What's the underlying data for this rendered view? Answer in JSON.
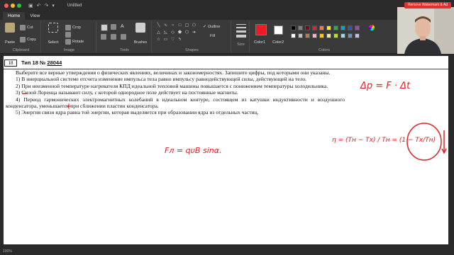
{
  "window": {
    "title": "Untitled"
  },
  "tabs": [
    "Home",
    "View"
  ],
  "ribbon": {
    "clipboard": {
      "paste": "Paste",
      "cut": "Cut",
      "copy": "Copy",
      "label": "Clipboard"
    },
    "image": {
      "select": "Select",
      "crop": "Crop",
      "rotate": "Rotate",
      "label": "Image"
    },
    "tools": {
      "label": "Tools",
      "brushes": "Brushes"
    },
    "shapes": {
      "outline": "Outline",
      "fill": "Fill",
      "label": "Shapes"
    },
    "size": {
      "label": "Size"
    },
    "colors": {
      "color1": "Color1",
      "color2": "Color2",
      "edit": "Edit colors",
      "label": "Colors",
      "swatches": [
        "#000000",
        "#7f7f7f",
        "#880015",
        "#ed1c24",
        "#ff7f27",
        "#fff200",
        "#22b14c",
        "#00a2e8",
        "#3f48cc",
        "#a349a4",
        "#ffffff",
        "#c3c3c3",
        "#b97a57",
        "#ffaec9",
        "#ffc90e",
        "#efe4b0",
        "#b5e61d",
        "#99d9ea",
        "#7092be",
        "#c8bfe7"
      ]
    }
  },
  "watermark": "Remove Watermark & Ad",
  "task": {
    "number": "18",
    "type_label": "Тип 18 №",
    "id": "28044",
    "intro": "Выберите все верные утверждения о физических явлениях, величинах и закономерностях. Запишите цифры, под которыми они указаны.",
    "items": [
      "1) В инерциальной системе отсчета изменение импульса тела равно импульсу равнодействующей силы, действующей на тело.",
      "2) При неизменной температуре нагревателя КПД идеальной тепловой машины повышается с понижением температуры холодильника.",
      "3) Силой Лоренца называют силу, с которой однородное поле действует на постоянные магниты.",
      "4) Период гармонических электромагнитных колебаний в идеальном контуре, состоящем из катушки индуктивности и воздушного конденсатора, уменьшается при сближении пластин конденсатора.",
      "5) Энергия связи ядра равна той энергии, которая выделяется при образовании ядра из отдельных частиц."
    ]
  },
  "annotations": {
    "momentum": "Δp = F · Δt",
    "lorentz": "Fл = qυB sinα.",
    "efficiency": "η = (Tн − Tх) / Tн = (1 − Tх/Tн)",
    "minus_mark": "−",
    "plus_mark": "+"
  },
  "status": {
    "left": "100%"
  }
}
